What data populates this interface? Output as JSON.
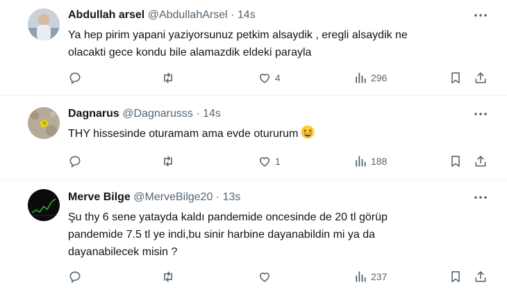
{
  "tweets": [
    {
      "name": "Abdullah arsel",
      "handle": "@AbdullahArsel",
      "dot": "·",
      "time": "14s",
      "text_lines": [
        "Ya hep pirim yapani yaziyorsunuz petkim alsaydik , eregli alsaydik  ne",
        "olacakti gece kondu bile alamazdik eldeki parayla"
      ],
      "reply_count": "",
      "retweet_count": "",
      "like_count": "4",
      "view_count": "296"
    },
    {
      "name": "Dagnarus",
      "handle": "@Dagnarusss",
      "dot": "·",
      "time": "14s",
      "text_lines": [
        "THY hissesinde oturamam ama evde otururum"
      ],
      "emoji": "grinning-squinting-face",
      "reply_count": "",
      "retweet_count": "",
      "like_count": "1",
      "view_count": "188"
    },
    {
      "name": "Merve Bilge",
      "handle": "@MerveBilge20",
      "dot": "·",
      "time": "13s",
      "text_lines": [
        "Şu thy 6 sene yatayda kaldı pandemide oncesinde de 20 tl görüp",
        "pandemide 7.5 tl ye indi,bu sinir harbine dayanabildin mi ya da",
        "dayanabilecek misin ?"
      ],
      "reply_count": "",
      "retweet_count": "",
      "like_count": "",
      "view_count": "237"
    }
  ],
  "icons": {
    "reply": "reply-icon",
    "retweet": "retweet-icon",
    "like": "like-icon",
    "views": "views-icon",
    "bookmark": "bookmark-icon",
    "share": "share-icon",
    "more": "more-icon"
  },
  "colors": {
    "text": "#0f1419",
    "secondary": "#536471",
    "divider": "#eff3f4"
  }
}
